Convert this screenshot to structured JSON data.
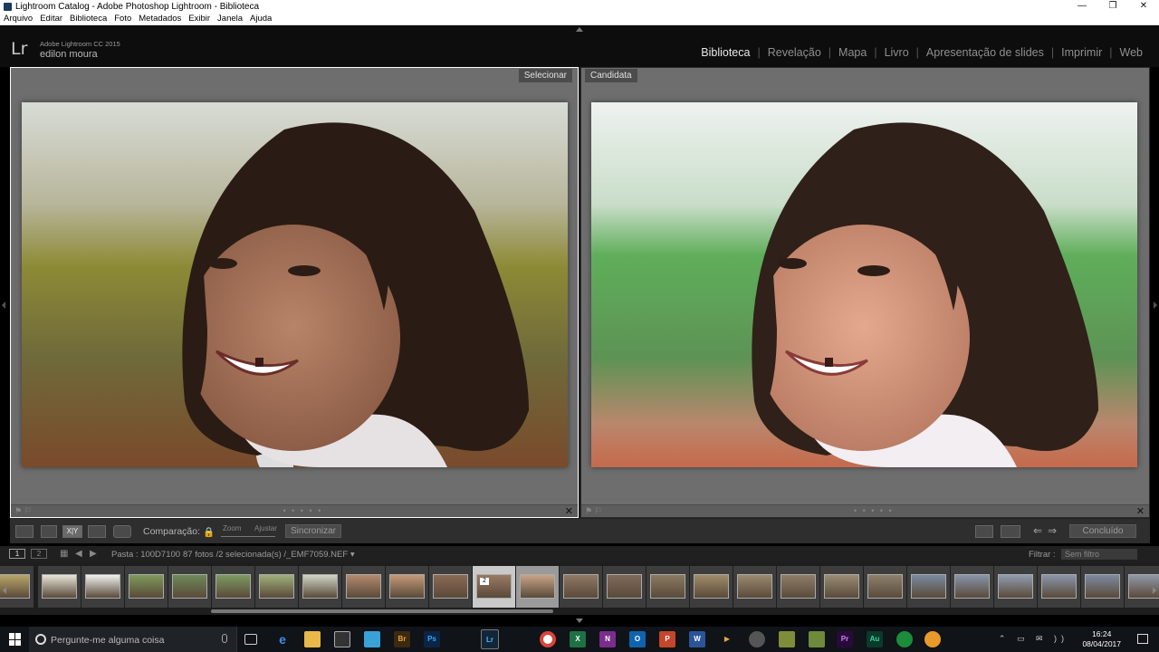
{
  "window": {
    "title": "Lightroom Catalog - Adobe Photoshop Lightroom - Biblioteca",
    "controls": [
      "—",
      "❐",
      "✕"
    ]
  },
  "menu": [
    "Arquivo",
    "Editar",
    "Biblioteca",
    "Foto",
    "Metadados",
    "Exibir",
    "Janela",
    "Ajuda"
  ],
  "identity": {
    "logo": "Lr",
    "product": "Adobe Lightroom CC 2015",
    "user": "edilon moura"
  },
  "modules": {
    "biblioteca": "Biblioteca",
    "revelacao": "Revelação",
    "mapa": "Mapa",
    "livro": "Livro",
    "apresentacao": "Apresentação de slides",
    "imprimir": "Imprimir",
    "web": "Web",
    "separator": "|"
  },
  "compare": {
    "left_label": "Selecionar",
    "right_label": "Candidata",
    "footer_dots": "• • • • •",
    "close": "✕",
    "flag": "⚑ ⚐"
  },
  "toolbar": {
    "compare_label": "Comparação:",
    "zoom_label": "Zoom",
    "fit_label": "Ajustar",
    "sync_label": "Sincronizar",
    "xy_label": "X|Y",
    "done_label": "Concluído",
    "swap_left": "⇐",
    "swap_right": "⇒"
  },
  "filmstrip_header": {
    "view1": "1",
    "view2": "2",
    "folder": "Pasta : 100D7100",
    "count": "87 fotos /2 selecionada(s) /_EMF7059.NEF ▾",
    "filter_label": "Filtrar :",
    "filter_value": "Sem filtro"
  },
  "filmstrip": {
    "selected_badge": "2"
  },
  "taskbar": {
    "search_placeholder": "Pergunte-me alguma coisa",
    "time": "16:24",
    "date": "08/04/2017",
    "tray": "⌃ ▭ ✉ ))"
  },
  "colors": {
    "lr_panel": "#0d0d0d",
    "compare_bg": "#6e6e6e",
    "active_module": "#e8e8e8"
  }
}
